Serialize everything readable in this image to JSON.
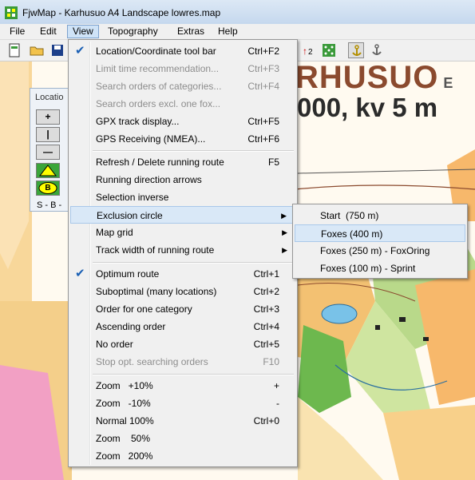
{
  "window": {
    "title": "FjwMap - Karhusuo A4 Landscape lowres.map"
  },
  "menubar": {
    "items": [
      "File",
      "Edit",
      "View",
      "Topography",
      "Extras",
      "Help"
    ]
  },
  "map": {
    "title_line1": "RHUSUO",
    "title_line1_suffix": "E",
    "title_line2": "000, kv 5 m"
  },
  "palette": {
    "title": "Locatio",
    "buttons": [
      "+",
      "|",
      "—"
    ],
    "label": "S - B -",
    "triangle_color": "#ffff00",
    "circle_label": "B"
  },
  "view_menu": {
    "items": [
      {
        "label": "Location/Coordinate tool bar",
        "shortcut": "Ctrl+F2",
        "checked": true
      },
      {
        "label": "Limit time recommendation...",
        "shortcut": "Ctrl+F3",
        "disabled": true
      },
      {
        "label": "Search orders of categories...",
        "shortcut": "Ctrl+F4",
        "disabled": true
      },
      {
        "label": "Search orders excl. one fox...",
        "shortcut": "",
        "disabled": true
      },
      {
        "label": "GPX track display...",
        "shortcut": "Ctrl+F5"
      },
      {
        "label": "GPS Receiving (NMEA)...",
        "shortcut": "Ctrl+F6"
      },
      {
        "label": "Refresh / Delete running route",
        "shortcut": "F5"
      },
      {
        "label": "Running direction arrows",
        "shortcut": ""
      },
      {
        "label": "Selection inverse",
        "shortcut": ""
      },
      {
        "label": "Exclusion circle",
        "submenu": true,
        "highlight": true
      },
      {
        "label": "Map grid",
        "submenu": true
      },
      {
        "label": "Track width of running route",
        "submenu": true
      },
      {
        "label": "Optimum route",
        "shortcut": "Ctrl+1",
        "checked": true
      },
      {
        "label": "Suboptimal (many locations)",
        "shortcut": "Ctrl+2"
      },
      {
        "label": "Order for one category",
        "shortcut": "Ctrl+3"
      },
      {
        "label": "Ascending order",
        "shortcut": "Ctrl+4"
      },
      {
        "label": "No order",
        "shortcut": "Ctrl+5"
      },
      {
        "label": "Stop opt. searching orders",
        "shortcut": "F10",
        "disabled": true
      },
      {
        "label": "Zoom   +10%",
        "shortcut": "+"
      },
      {
        "label": "Zoom   -10%",
        "shortcut": "-"
      },
      {
        "label": "Normal 100%",
        "shortcut": "Ctrl+0"
      },
      {
        "label": "Zoom    50%",
        "shortcut": ""
      },
      {
        "label": "Zoom   200%",
        "shortcut": ""
      }
    ]
  },
  "exclusion_submenu": {
    "items": [
      {
        "label": "Start  (750 m)"
      },
      {
        "label": "Foxes (400 m)",
        "highlight": true
      },
      {
        "label": "Foxes (250 m) - FoxOring"
      },
      {
        "label": "Foxes (100 m) - Sprint"
      }
    ]
  },
  "colors": {
    "accent": "#1a5fb4",
    "highlight": "#d9e8f7",
    "map_orange": "#f8c77a",
    "map_green": "#b9d98a",
    "map_dark_green": "#6db84e",
    "map_brown": "#8b4a2e",
    "map_blue": "#79c2e8"
  }
}
